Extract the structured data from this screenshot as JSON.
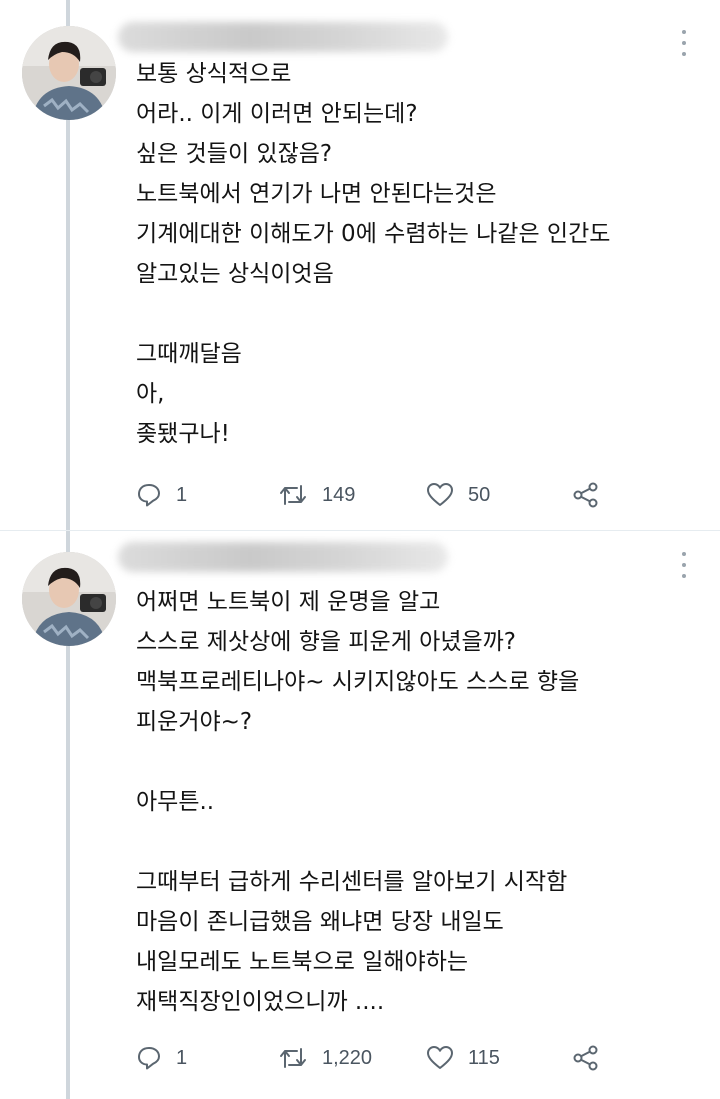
{
  "tweets": [
    {
      "lines": [
        "보통 상식적으로",
        "어라.. 이게 이러면 안되는데?",
        "싶은 것들이 있잖음?",
        "노트북에서 연기가 나면 안된다는것은",
        "기계에대한 이해도가 0에 수렴하는 나같은 인간도",
        "알고있는 상식이엇음",
        "",
        "그때깨달음",
        "아,",
        "좆됐구나!"
      ],
      "replies": "1",
      "retweets": "149",
      "likes": "50"
    },
    {
      "lines": [
        "어쩌면 노트북이 제 운명을 알고",
        "스스로 제삿상에 향을 피운게 아녔을까?",
        "맥북프로레티나야~ 시키지않아도 스스로 향을",
        "피운거야~?",
        "",
        "아무튼..",
        "",
        "그때부터 급하게 수리센터를 알아보기 시작함",
        "마음이 존니급했음  왜냐면 당장 내일도",
        "내일모레도 노트북으로 일해야하는",
        "재택직장인이었으니까 ...."
      ],
      "replies": "1",
      "retweets": "1,220",
      "likes": "115"
    }
  ],
  "icons": {
    "reply": "reply-icon",
    "retweet": "retweet-icon",
    "like": "heart-icon",
    "share": "share-icon",
    "more": "more-vertical-icon"
  },
  "colors": {
    "icon": "#5b6670",
    "thread_line": "#cfd6dc"
  }
}
